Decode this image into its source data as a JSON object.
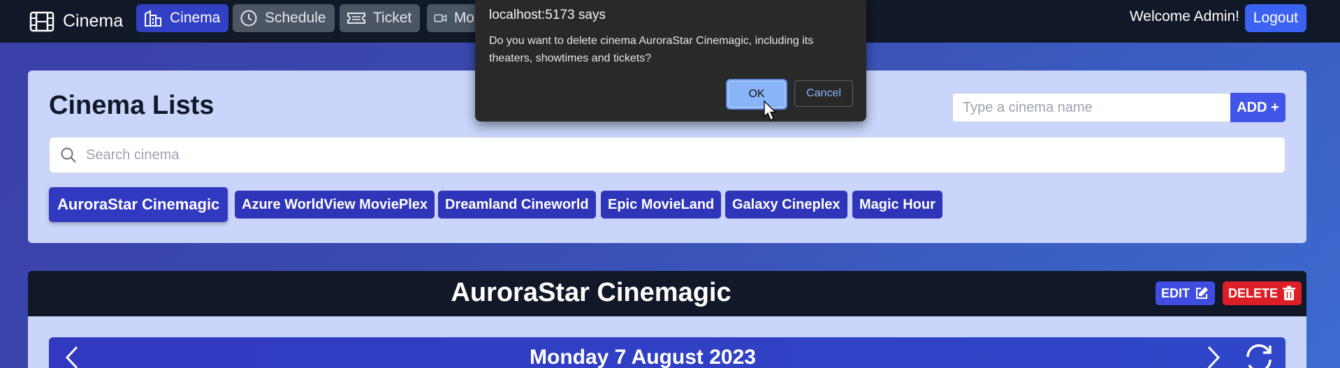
{
  "navbar": {
    "brand": "Cinema",
    "items": [
      {
        "label": "Cinema",
        "icon": "building-icon",
        "active": true
      },
      {
        "label": "Schedule",
        "icon": "clock-icon",
        "active": false
      },
      {
        "label": "Ticket",
        "icon": "ticket-icon",
        "active": false
      },
      {
        "label": "Mo",
        "icon": "video-icon",
        "active": false
      }
    ],
    "welcome": "Welcome Admin!",
    "logout": "Logout"
  },
  "cinema_panel": {
    "title": "Cinema Lists",
    "add_placeholder": "Type a cinema name",
    "add_label": "ADD +",
    "search_placeholder": "Search cinema",
    "chips": [
      "AuroraStar Cinemagic",
      "Azure WorldView MoviePlex",
      "Dreamland Cineworld",
      "Epic MovieLand",
      "Galaxy Cineplex",
      "Magic Hour"
    ],
    "selected": "AuroraStar Cinemagic"
  },
  "detail": {
    "title": "AuroraStar Cinemagic",
    "edit_label": "EDIT",
    "delete_label": "DELETE",
    "date": "Monday 7 August 2023"
  },
  "dialog": {
    "title": "localhost:5173 says",
    "message": "Do you want to delete cinema AuroraStar Cinemagic, including its theaters, showtimes and tickets?",
    "ok": "OK",
    "cancel": "Cancel"
  },
  "colors": {
    "navbar": "#111827",
    "accent": "#3140c4",
    "danger": "#dc1f26",
    "panel": "#c9d5fb"
  }
}
